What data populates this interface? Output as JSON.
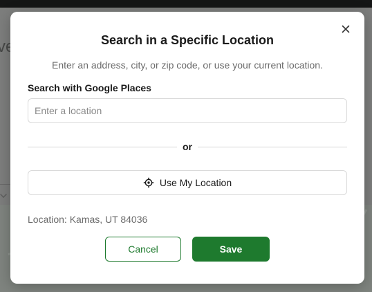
{
  "modal": {
    "title": "Search in a Specific Location",
    "subtitle": "Enter an address, city, or zip code, or use your current location.",
    "search_label": "Search with Google Places",
    "search_placeholder": "Enter a location",
    "search_value": "",
    "divider_text": "or",
    "use_location_label": "Use My Location",
    "use_location_icon": "crosshair-icon",
    "close_icon": "close-icon",
    "location_status": "Location: Kamas, UT 84036",
    "cancel_label": "Cancel",
    "save_label": "Save"
  },
  "background": {
    "heading_fragment": "ve",
    "field_fragment": "nc"
  },
  "colors": {
    "accent": "#1e7a2e",
    "overlay": "#7d7e7d",
    "topbar": "#151616"
  }
}
